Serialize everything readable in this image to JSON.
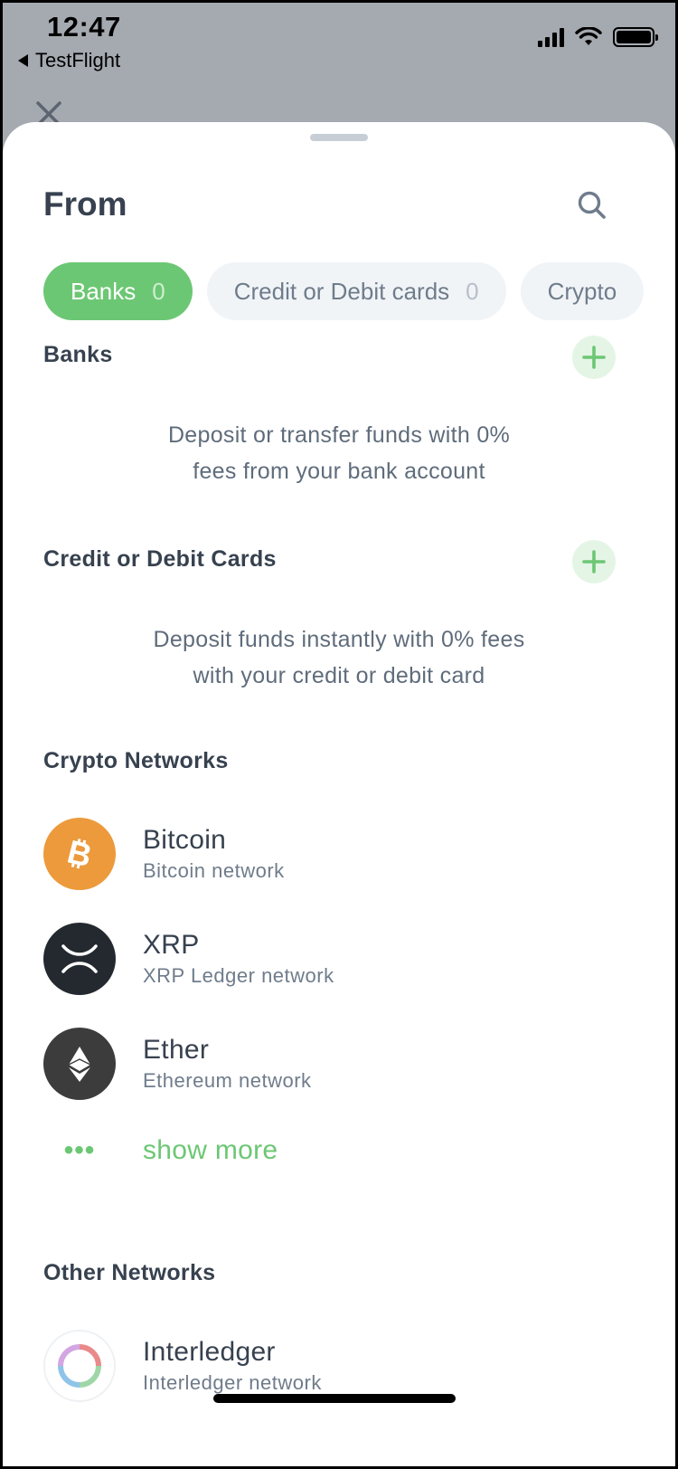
{
  "status_bar": {
    "time": "12:47",
    "back_app": "TestFlight"
  },
  "sheet": {
    "title": "From",
    "tabs": [
      {
        "label": "Banks",
        "count": "0",
        "active": true
      },
      {
        "label": "Credit or Debit cards",
        "count": "0",
        "active": false
      },
      {
        "label": "Crypto",
        "count": "",
        "active": false
      }
    ],
    "sections": {
      "banks": {
        "heading": "Banks",
        "description_line1": "Deposit or transfer funds with 0%",
        "description_line2": "fees from your bank account"
      },
      "cards": {
        "heading": "Credit or Debit Cards",
        "description_line1": "Deposit funds instantly with 0% fees",
        "description_line2": "with your credit or debit card"
      },
      "crypto": {
        "heading": "Crypto Networks",
        "networks": [
          {
            "name": "Bitcoin",
            "network": "Bitcoin network",
            "icon": "bitcoin-icon",
            "color": "#ec9a3c"
          },
          {
            "name": "XRP",
            "network": "XRP Ledger network",
            "icon": "xrp-icon",
            "color": "#23292f"
          },
          {
            "name": "Ether",
            "network": "Ethereum network",
            "icon": "ethereum-icon",
            "color": "#3c3c3d"
          }
        ],
        "show_more": "show more",
        "show_more_dots": "•••"
      },
      "other": {
        "heading": "Other Networks",
        "networks": [
          {
            "name": "Interledger",
            "network": "Interledger network",
            "icon": "interledger-icon"
          }
        ]
      }
    }
  },
  "colors": {
    "accent_green": "#6cc774",
    "text_dark": "#37414f",
    "text_muted": "#6f7c8b",
    "backdrop": "#a5a9b0"
  }
}
